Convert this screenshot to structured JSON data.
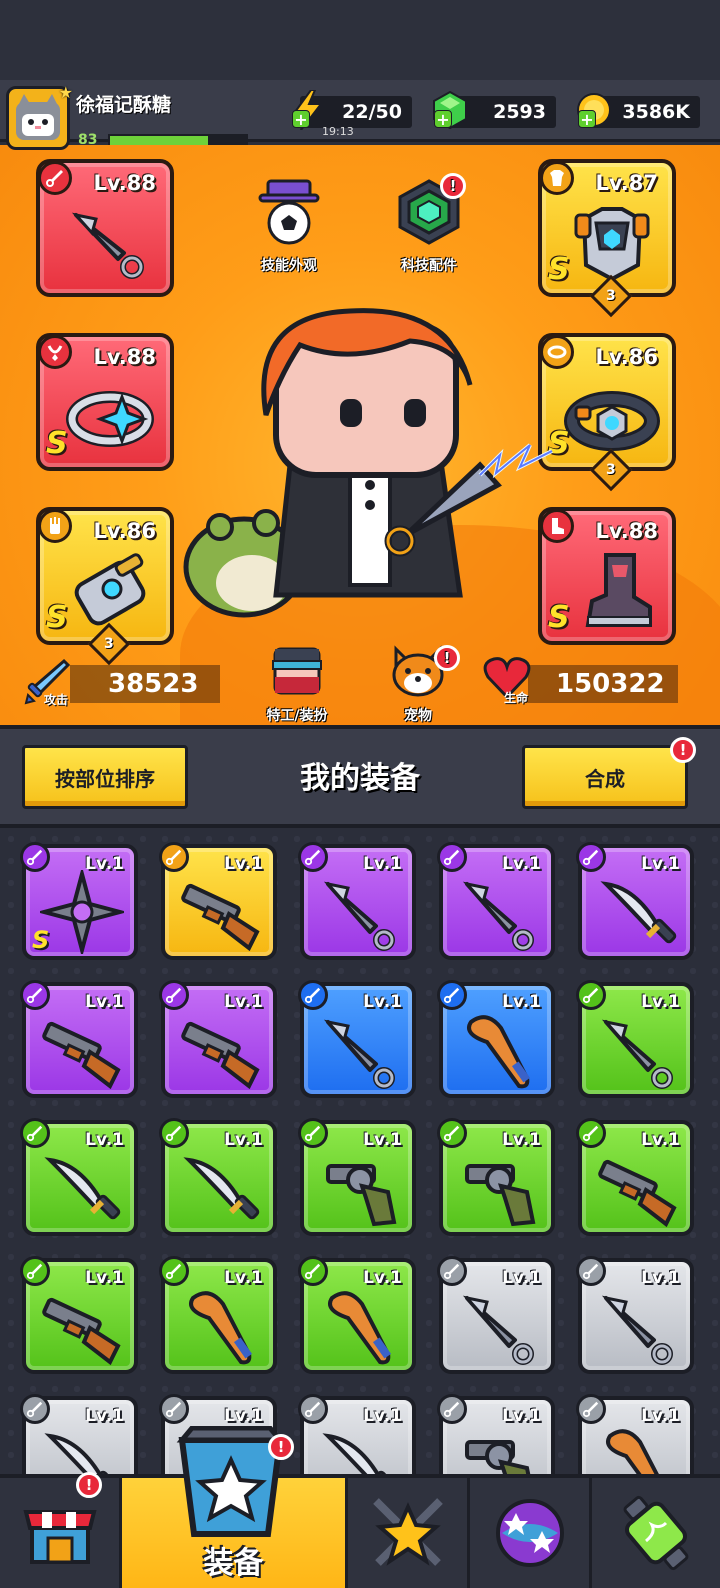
{
  "player": {
    "name": "徐福记酥糖",
    "level": "83",
    "xp_progress": 0.72
  },
  "resources": {
    "energy": "22/50",
    "energy_timer": "19:13",
    "gems": "2593",
    "gold": "3586K"
  },
  "hero_slots": [
    {
      "id": "weapon",
      "level": "Lv.88",
      "rarity": "red",
      "grade": "",
      "stars": "",
      "icon": "kunai-icon"
    },
    {
      "id": "armor",
      "level": "Lv.87",
      "rarity": "gold",
      "grade": "S",
      "stars": "3",
      "icon": "armor-icon"
    },
    {
      "id": "necklace",
      "level": "Lv.88",
      "rarity": "red",
      "grade": "S",
      "stars": "",
      "icon": "ring-icon"
    },
    {
      "id": "belt",
      "level": "Lv.86",
      "rarity": "gold",
      "grade": "S",
      "stars": "3",
      "icon": "belt-icon"
    },
    {
      "id": "gloves",
      "level": "Lv.86",
      "rarity": "gold",
      "grade": "S",
      "stars": "3",
      "icon": "gauntlet-icon"
    },
    {
      "id": "boots",
      "level": "Lv.88",
      "rarity": "red",
      "grade": "S",
      "stars": "",
      "icon": "boot-icon"
    }
  ],
  "hero_buttons": {
    "skill_skin": "技能外观",
    "tech_parts": "科技配件",
    "agent_outfit": "特工/装扮",
    "pet": "宠物"
  },
  "stats": {
    "attack_label": "攻击",
    "attack": "38523",
    "hp_label": "生命",
    "hp": "150322"
  },
  "equip_header": {
    "sort_label": "按部位排序",
    "title": "我的装备",
    "merge_label": "合成",
    "notif": "!"
  },
  "inventory": [
    {
      "rarity": "purple",
      "level": "Lv.1",
      "grade": "S",
      "icon": "shuriken-icon"
    },
    {
      "rarity": "gold",
      "level": "Lv.1",
      "grade": "",
      "icon": "shotgun-icon"
    },
    {
      "rarity": "purple",
      "level": "Lv.1",
      "grade": "",
      "icon": "kunai-icon"
    },
    {
      "rarity": "purple",
      "level": "Lv.1",
      "grade": "",
      "icon": "kunai-icon"
    },
    {
      "rarity": "purple",
      "level": "Lv.1",
      "grade": "",
      "icon": "machete-icon"
    },
    {
      "rarity": "purple",
      "level": "Lv.1",
      "grade": "",
      "icon": "shotgun-icon"
    },
    {
      "rarity": "purple",
      "level": "Lv.1",
      "grade": "",
      "icon": "shotgun-icon"
    },
    {
      "rarity": "blue",
      "level": "Lv.1",
      "grade": "",
      "icon": "kunai-icon"
    },
    {
      "rarity": "blue",
      "level": "Lv.1",
      "grade": "",
      "icon": "bat-icon"
    },
    {
      "rarity": "green",
      "level": "Lv.1",
      "grade": "",
      "icon": "kunai-icon"
    },
    {
      "rarity": "green",
      "level": "Lv.1",
      "grade": "",
      "icon": "machete-icon"
    },
    {
      "rarity": "green",
      "level": "Lv.1",
      "grade": "",
      "icon": "machete-icon"
    },
    {
      "rarity": "green",
      "level": "Lv.1",
      "grade": "",
      "icon": "revolver-icon"
    },
    {
      "rarity": "green",
      "level": "Lv.1",
      "grade": "",
      "icon": "revolver-icon"
    },
    {
      "rarity": "green",
      "level": "Lv.1",
      "grade": "",
      "icon": "shotgun-icon"
    },
    {
      "rarity": "green",
      "level": "Lv.1",
      "grade": "",
      "icon": "shotgun-icon"
    },
    {
      "rarity": "green",
      "level": "Lv.1",
      "grade": "",
      "icon": "bat-icon"
    },
    {
      "rarity": "green",
      "level": "Lv.1",
      "grade": "",
      "icon": "bat-icon"
    },
    {
      "rarity": "gray",
      "level": "Lv.1",
      "grade": "",
      "icon": "kunai-icon"
    },
    {
      "rarity": "gray",
      "level": "Lv.1",
      "grade": "",
      "icon": "kunai-icon"
    },
    {
      "rarity": "gray",
      "level": "Lv.1",
      "grade": "",
      "icon": "machete-icon"
    },
    {
      "rarity": "gray",
      "level": "Lv.1",
      "grade": "",
      "icon": "kunai-icon"
    },
    {
      "rarity": "gray",
      "level": "Lv.1",
      "grade": "",
      "icon": "machete-icon"
    },
    {
      "rarity": "gray",
      "level": "Lv.1",
      "grade": "",
      "icon": "revolver-icon"
    },
    {
      "rarity": "gray",
      "level": "Lv.1",
      "grade": "",
      "icon": "bat-icon"
    }
  ],
  "nav": {
    "active_label": "装备",
    "tabs": [
      "shop-icon",
      "equipment-icon",
      "skills-icon",
      "planet-icon",
      "gene-icon"
    ]
  },
  "colors": {
    "accent": "#ffd23a",
    "alert": "#e8283a"
  }
}
